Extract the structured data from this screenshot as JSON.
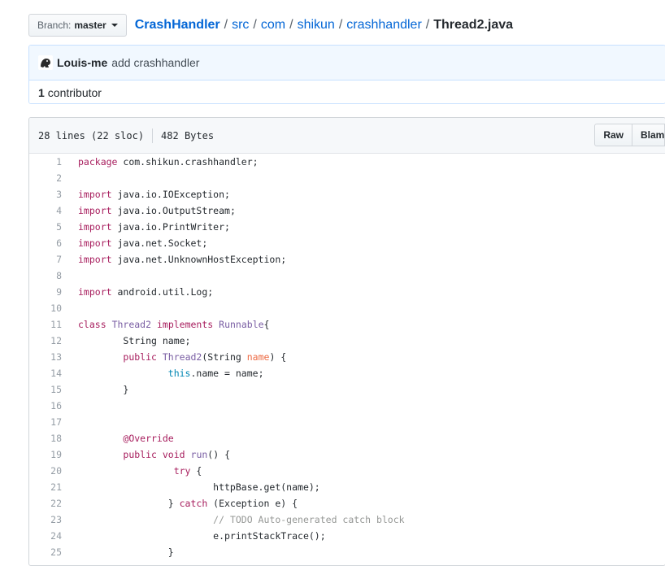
{
  "branch": {
    "prefix": "Branch:",
    "name": "master"
  },
  "breadcrumb": {
    "root": "CrashHandler",
    "parts": [
      "src",
      "com",
      "shikun",
      "crashhandler"
    ],
    "file": "Thread2.java",
    "sep": "/"
  },
  "commit": {
    "author": "Louis-me",
    "message": "add crashhandler"
  },
  "contributors": {
    "count": "1",
    "label": "contributor"
  },
  "file_info": {
    "lines": "28 lines (22 sloc)",
    "size": "482 Bytes"
  },
  "buttons": {
    "raw": "Raw",
    "blame": "Blame"
  },
  "colors": {
    "keyword": "#a71d5d",
    "entity": "#795da3",
    "variable": "#ed6a43",
    "constant": "#0086b3",
    "comment": "#969896",
    "link": "#0366d6"
  },
  "code_lines": [
    {
      "n": "1",
      "tokens": [
        [
          "kw",
          "package"
        ],
        [
          "pl",
          " com.shikun.crashhandler;"
        ]
      ]
    },
    {
      "n": "2",
      "tokens": []
    },
    {
      "n": "3",
      "tokens": [
        [
          "kw",
          "import"
        ],
        [
          "pl",
          " java.io.IOException;"
        ]
      ]
    },
    {
      "n": "4",
      "tokens": [
        [
          "kw",
          "import"
        ],
        [
          "pl",
          " java.io.OutputStream;"
        ]
      ]
    },
    {
      "n": "5",
      "tokens": [
        [
          "kw",
          "import"
        ],
        [
          "pl",
          " java.io.PrintWriter;"
        ]
      ]
    },
    {
      "n": "6",
      "tokens": [
        [
          "kw",
          "import"
        ],
        [
          "pl",
          " java.net.Socket;"
        ]
      ]
    },
    {
      "n": "7",
      "tokens": [
        [
          "kw",
          "import"
        ],
        [
          "pl",
          " java.net.UnknownHostException;"
        ]
      ]
    },
    {
      "n": "8",
      "tokens": []
    },
    {
      "n": "9",
      "tokens": [
        [
          "kw",
          "import"
        ],
        [
          "pl",
          " android.util.Log;"
        ]
      ]
    },
    {
      "n": "10",
      "tokens": []
    },
    {
      "n": "11",
      "tokens": [
        [
          "kw",
          "class"
        ],
        [
          "pl",
          " "
        ],
        [
          "ent",
          "Thread2"
        ],
        [
          "pl",
          " "
        ],
        [
          "kw",
          "implements"
        ],
        [
          "pl",
          " "
        ],
        [
          "ent",
          "Runnable"
        ],
        [
          "pl",
          "{"
        ]
      ]
    },
    {
      "n": "12",
      "tokens": [
        [
          "pl",
          "        String name;"
        ]
      ]
    },
    {
      "n": "13",
      "tokens": [
        [
          "pl",
          "        "
        ],
        [
          "kw",
          "public"
        ],
        [
          "pl",
          " "
        ],
        [
          "ent",
          "Thread2"
        ],
        [
          "pl",
          "(String "
        ],
        [
          "var",
          "name"
        ],
        [
          "pl",
          ") {"
        ]
      ]
    },
    {
      "n": "14",
      "tokens": [
        [
          "pl",
          "                "
        ],
        [
          "const",
          "this"
        ],
        [
          "pl",
          ".name = name;"
        ]
      ]
    },
    {
      "n": "15",
      "tokens": [
        [
          "pl",
          "        }"
        ]
      ]
    },
    {
      "n": "16",
      "tokens": []
    },
    {
      "n": "17",
      "tokens": []
    },
    {
      "n": "18",
      "tokens": [
        [
          "pl",
          "        "
        ],
        [
          "ann",
          "@Override"
        ]
      ]
    },
    {
      "n": "19",
      "tokens": [
        [
          "pl",
          "        "
        ],
        [
          "kw",
          "public"
        ],
        [
          "pl",
          " "
        ],
        [
          "kw",
          "void"
        ],
        [
          "pl",
          " "
        ],
        [
          "ent",
          "run"
        ],
        [
          "pl",
          "() {"
        ]
      ]
    },
    {
      "n": "20",
      "tokens": [
        [
          "pl",
          "                 "
        ],
        [
          "kw",
          "try"
        ],
        [
          "pl",
          " {"
        ]
      ]
    },
    {
      "n": "21",
      "tokens": [
        [
          "pl",
          "                        httpBase.get(name);"
        ]
      ]
    },
    {
      "n": "22",
      "tokens": [
        [
          "pl",
          "                } "
        ],
        [
          "kw",
          "catch"
        ],
        [
          "pl",
          " (Exception e) {"
        ]
      ]
    },
    {
      "n": "23",
      "tokens": [
        [
          "pl",
          "                        "
        ],
        [
          "com",
          "// TODO Auto-generated catch block"
        ]
      ]
    },
    {
      "n": "24",
      "tokens": [
        [
          "pl",
          "                        e.printStackTrace();"
        ]
      ]
    },
    {
      "n": "25",
      "tokens": [
        [
          "pl",
          "                }"
        ]
      ]
    }
  ]
}
